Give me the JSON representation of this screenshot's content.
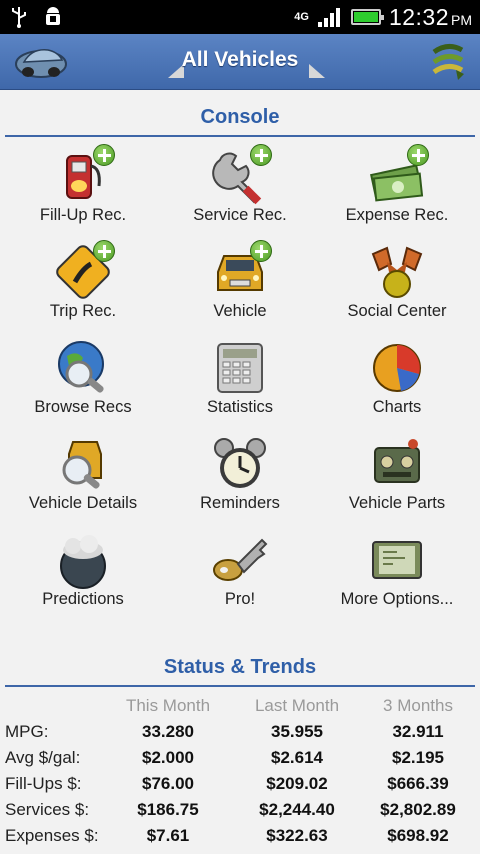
{
  "status_bar": {
    "icons": [
      "usb-icon",
      "android-debug-icon"
    ],
    "network": "4G",
    "time": "12:32",
    "ampm": "PM",
    "battery_color": "#2ecc2e"
  },
  "header": {
    "title": "All Vehicles",
    "accent": "#4a74b8"
  },
  "console": {
    "title": "Console",
    "items": [
      {
        "label": "Fill-Up Rec.",
        "icon": "fuel-pump-icon"
      },
      {
        "label": "Service Rec.",
        "icon": "wrench-icon"
      },
      {
        "label": "Expense Rec.",
        "icon": "money-icon"
      },
      {
        "label": "Trip Rec.",
        "icon": "road-sign-icon"
      },
      {
        "label": "Vehicle",
        "icon": "car-icon"
      },
      {
        "label": "Social Center",
        "icon": "social-icon"
      },
      {
        "label": "Browse Recs",
        "icon": "globe-magnifier-icon"
      },
      {
        "label": "Statistics",
        "icon": "calculator-icon"
      },
      {
        "label": "Charts",
        "icon": "pie-chart-icon"
      },
      {
        "label": "Vehicle Details",
        "icon": "car-details-icon"
      },
      {
        "label": "Reminders",
        "icon": "alarm-clock-icon"
      },
      {
        "label": "Vehicle Parts",
        "icon": "car-parts-icon"
      },
      {
        "label": "Predictions",
        "icon": "cloud-icon"
      },
      {
        "label": "Pro!",
        "icon": "key-icon"
      },
      {
        "label": "More Options...",
        "icon": "more-options-icon"
      }
    ]
  },
  "status_trends": {
    "title": "Status & Trends",
    "columns": [
      "This Month",
      "Last Month",
      "3 Months"
    ],
    "rows": [
      {
        "label": "MPG:",
        "values": [
          "33.280",
          "35.955",
          "32.911"
        ]
      },
      {
        "label": "Avg $/gal:",
        "values": [
          "$2.000",
          "$2.614",
          "$2.195"
        ]
      },
      {
        "label": "Fill-Ups $:",
        "values": [
          "$76.00",
          "$209.02",
          "$666.39"
        ]
      },
      {
        "label": "Services $:",
        "values": [
          "$186.75",
          "$2,244.40",
          "$2,802.89"
        ]
      },
      {
        "label": "Expenses $:",
        "values": [
          "$7.61",
          "$322.63",
          "$698.92"
        ]
      }
    ]
  }
}
